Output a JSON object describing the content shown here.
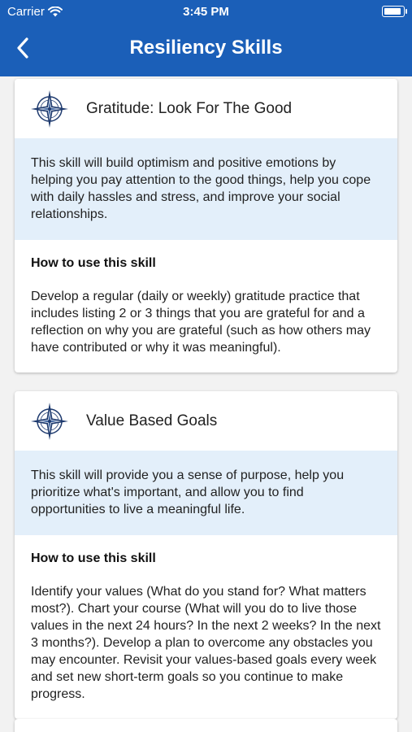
{
  "status": {
    "carrier": "Carrier",
    "time": "3:45 PM"
  },
  "nav": {
    "title": "Resiliency Skills"
  },
  "skills": [
    {
      "title": "Gratitude: Look For The Good",
      "description": "This skill will build optimism and positive emotions by helping you pay attention to the good things, help you cope with daily hassles and stress, and improve your social relationships.",
      "howto_label": "How to use this skill",
      "howto_text": "Develop a regular (daily or weekly) gratitude practice that includes listing 2 or 3 things that you are grateful for and a reflection on why you are grateful (such as how others may have contributed or why it was meaningful)."
    },
    {
      "title": "Value Based Goals",
      "description": "This skill will provide you a sense of purpose, help you prioritize what's important, and allow you to find opportunities to live a meaningful life.",
      "howto_label": "How to use this skill",
      "howto_text": "Identify your values (What do you stand for? What matters most?).  Chart your course (What will you do to live those values in the next 24 hours?  In the next 2 weeks? In the next 3 months?). Develop a plan to overcome any obstacles you may encounter. Revisit your values-based goals every week and set new short-term goals so you continue to make progress."
    }
  ],
  "colors": {
    "header": "#1b5fb8",
    "description_bg": "#e3effa",
    "icon": "#1e3a6e"
  },
  "icons": {
    "back": "chevron-left-icon",
    "skill": "compass-rose-icon",
    "wifi": "wifi-icon",
    "battery": "battery-icon"
  }
}
